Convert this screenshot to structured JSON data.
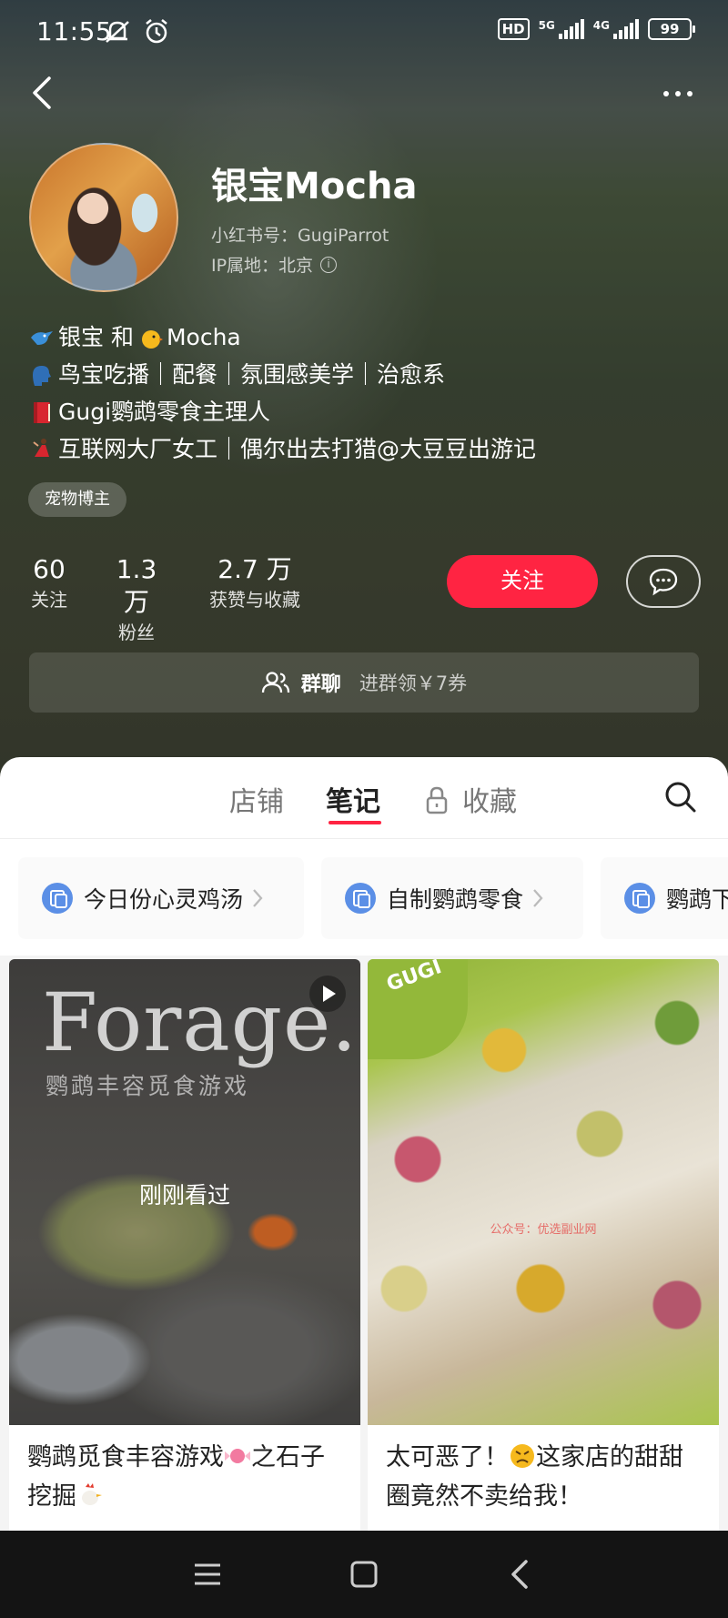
{
  "status_bar": {
    "time": "11:55",
    "hd_label": "HD",
    "net1": "5G",
    "net2": "4G",
    "battery": "99"
  },
  "profile": {
    "name": "银宝Mocha",
    "red_id": "小红书号：GugiParrot",
    "ip_location": "IP属地：北京",
    "bio": [
      "银宝 和",
      "Mocha",
      "鸟宝吃播｜配餐｜氛围感美学｜治愈系",
      "Gugi鹦鹉零食主理人",
      "互联网大厂女工｜偶尔出去打猎@大豆豆出游记"
    ],
    "tag": "宠物博主",
    "stats": {
      "following_num": "60",
      "following_label": "关注",
      "fans_num": "1.3 万",
      "fans_label": "粉丝",
      "likes_num": "2.7 万",
      "likes_label": "获赞与收藏"
    },
    "follow_label": "关注",
    "group_title": "群聊",
    "group_sub": "进群领￥7券"
  },
  "tabs": [
    "店铺",
    "笔记",
    "收藏"
  ],
  "active_tab": "笔记",
  "chips": [
    "今日份心灵鸡汤",
    "自制鹦鹉零食",
    "鹦鹉下"
  ],
  "cards": [
    {
      "image_title": "Forage.",
      "image_subtitle": "鹦鹉丰容觅食游戏",
      "overlay": "刚刚看过",
      "title": "鹦鹉觅食丰容游戏",
      "title_rest": "之石子挖掘"
    },
    {
      "brand": "GUGI",
      "watermark": "公众号：优选副业网",
      "title": "太可恶了！",
      "title_rest": "这家店的甜甜圈竟然不卖给我！"
    }
  ],
  "colors": {
    "accent": "#ff2442",
    "chip_icon": "#5b8fe6"
  }
}
